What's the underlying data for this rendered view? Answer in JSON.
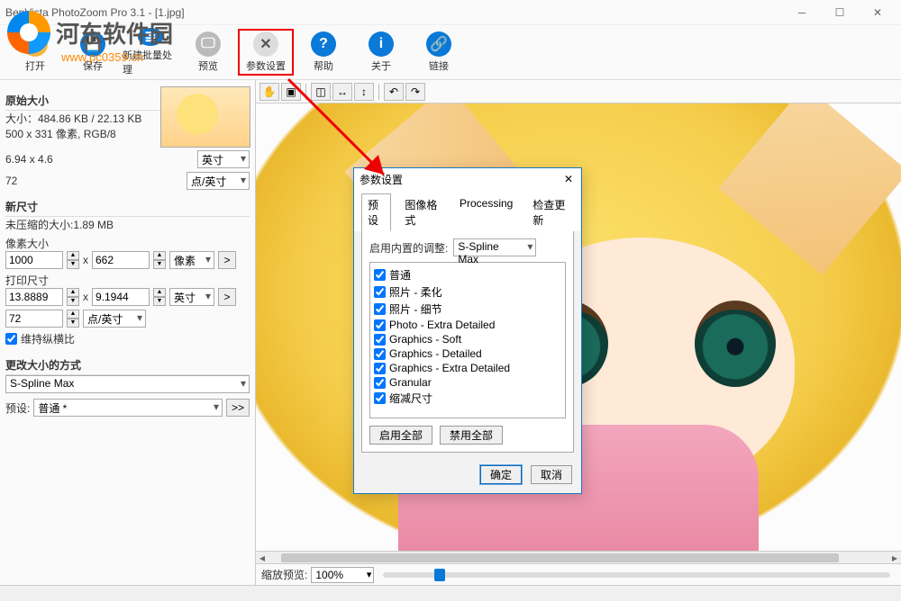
{
  "window": {
    "title": "BenVista PhotoZoom Pro 3.1 - [1.jpg]"
  },
  "watermark": {
    "text": "河东软件园",
    "url": "www.pc0359.cn"
  },
  "toolbar": {
    "open": "打开",
    "save": "保存",
    "batch": "新建批量处理",
    "preview": "预览",
    "settings": "参数设置",
    "help": "帮助",
    "about": "关于",
    "link": "链接"
  },
  "panel": {
    "orig_size_hdr": "原始大小",
    "size_line": "大小：484.86 KB / 22.13 KB",
    "dims_line": "500 x 331 像素, RGB/8",
    "print_val": "6.94 x 4.6",
    "print_unit": "英寸",
    "dpi_val": "72",
    "dpi_unit": "点/英寸",
    "new_size_hdr": "新尺寸",
    "uncompressed": "未压缩的大小:1.89 MB",
    "pixel_size_label": "像素大小",
    "width": "1000",
    "height": "662",
    "pixel_unit": "像素",
    "print_size_label": "打印尺寸",
    "print_w": "13.8889",
    "print_h": "9.1944",
    "new_print_unit": "英寸",
    "new_dpi": "72",
    "new_dpi_unit": "点/英寸",
    "keep_ratio": "维持纵横比",
    "resize_method_hdr": "更改大小的方式",
    "method": "S-Spline Max",
    "preset_label": "预设:",
    "preset_value": "普通 *"
  },
  "dialog": {
    "title": "参数设置",
    "tabs": {
      "presets": "预设",
      "format": "图像格式",
      "processing": "Processing",
      "update": "检查更新"
    },
    "builtin_label": "启用内置的调整:",
    "builtin_value": "S-Spline Max",
    "items": [
      "普通",
      "照片 - 柔化",
      "照片 - 细节",
      "Photo - Extra Detailed",
      "Graphics - Soft",
      "Graphics - Detailed",
      "Graphics - Extra Detailed",
      "Granular",
      "缩减尺寸"
    ],
    "enable_all": "启用全部",
    "disable_all": "禁用全部",
    "ok": "确定",
    "cancel": "取消"
  },
  "bottom": {
    "zoom_label": "缩放预览:",
    "zoom_value": "100%"
  }
}
